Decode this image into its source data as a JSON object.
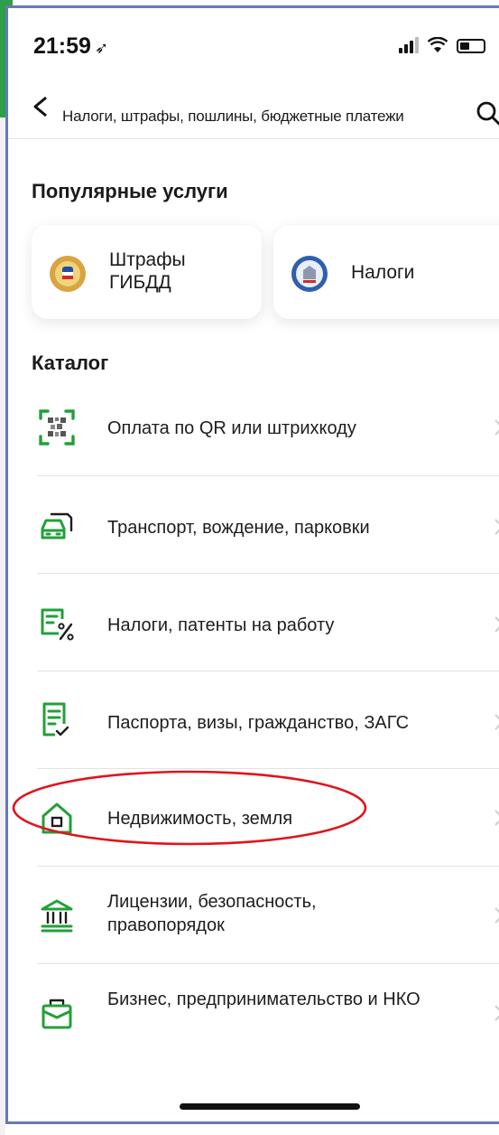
{
  "status": {
    "time": "21:59",
    "time_icon": "location-arrow-icon"
  },
  "nav": {
    "title": "Налоги, штрафы, пошлины, бюджетные платежи"
  },
  "popular": {
    "title": "Популярные услуги",
    "cards": [
      {
        "label": "Штрафы\nГИБДД",
        "icon": "traffic-police-emblem-icon"
      },
      {
        "label": "Налоги",
        "icon": "tax-service-emblem-icon"
      }
    ]
  },
  "catalog": {
    "title": "Каталог",
    "items": [
      {
        "label": "Оплата по QR или штрихкоду",
        "icon": "qr-scan-icon"
      },
      {
        "label": "Транспорт, вождение, парковки",
        "icon": "car-icon"
      },
      {
        "label": "Налоги, патенты на работу",
        "icon": "document-percent-icon"
      },
      {
        "label": "Паспорта, визы, гражданство, ЗАГС",
        "icon": "document-check-icon"
      },
      {
        "label": "Недвижимость, земля",
        "icon": "house-icon"
      },
      {
        "label": "Лицензии, безопасность, правопорядок",
        "icon": "government-building-icon"
      },
      {
        "label": "Бизнес, предпринимательство и НКО",
        "icon": "briefcase-icon"
      }
    ]
  },
  "colors": {
    "accent": "#21a038",
    "highlight": "#e0141c",
    "frame": "#6a78b6"
  }
}
